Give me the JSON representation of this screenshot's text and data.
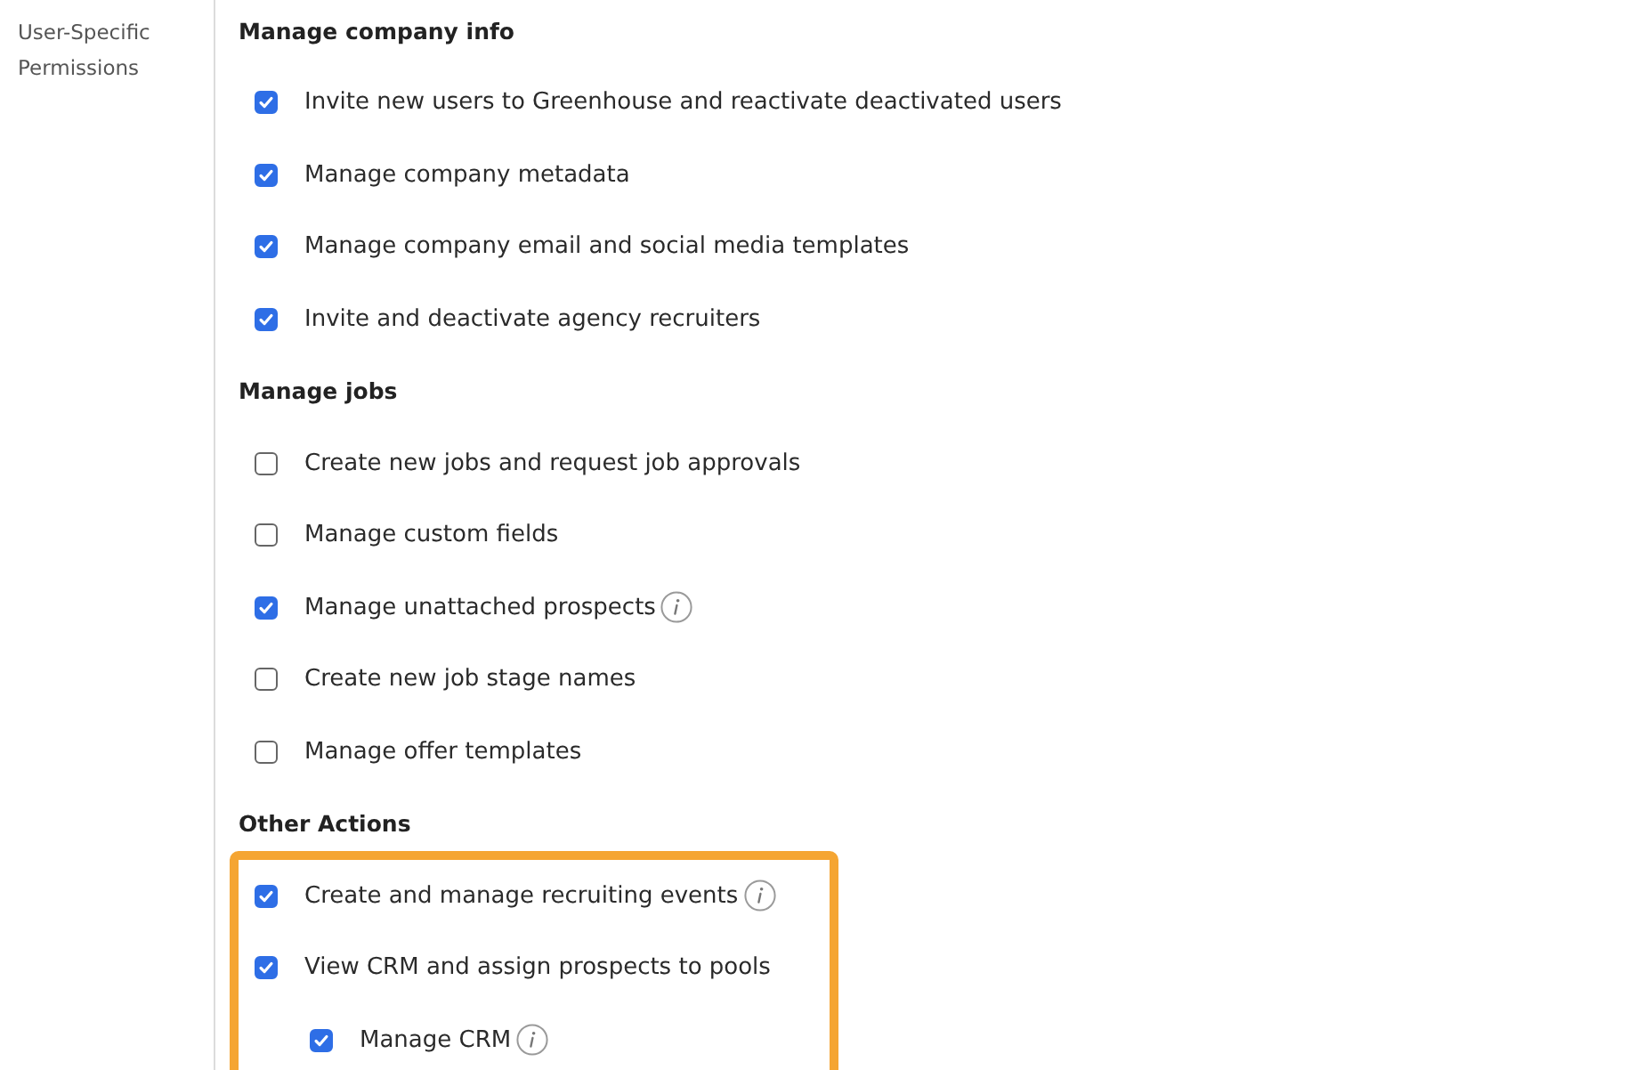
{
  "sidebar": {
    "label": "User-Specific Permissions"
  },
  "sections": [
    {
      "title": "Manage company info",
      "items": [
        {
          "label": "Invite new users to Greenhouse and reactivate deactivated users",
          "checked": true
        },
        {
          "label": "Manage company metadata",
          "checked": true
        },
        {
          "label": "Manage company email and social media templates",
          "checked": true
        },
        {
          "label": "Invite and deactivate agency recruiters",
          "checked": true
        }
      ]
    },
    {
      "title": "Manage jobs",
      "items": [
        {
          "label": "Create new jobs and request job approvals",
          "checked": false
        },
        {
          "label": "Manage custom fields",
          "checked": false
        },
        {
          "label": "Manage unattached prospects",
          "checked": true,
          "info": true
        },
        {
          "label": "Create new job stage names",
          "checked": false
        },
        {
          "label": "Manage offer templates",
          "checked": false
        }
      ]
    },
    {
      "title": "Other Actions",
      "highlighted": true,
      "items": [
        {
          "label": "Create and manage recruiting events",
          "checked": true,
          "info": true
        },
        {
          "label": "View CRM and assign prospects to pools",
          "checked": true,
          "children": [
            {
              "label": "Manage CRM",
              "checked": true,
              "info": true
            }
          ]
        }
      ]
    }
  ]
}
